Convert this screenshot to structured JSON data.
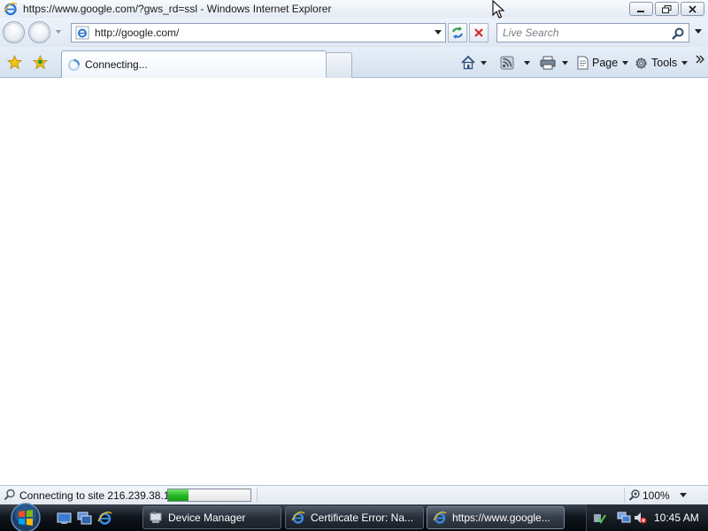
{
  "window": {
    "title": "https://www.google.com/?gws_rd=ssl - Windows Internet Explorer"
  },
  "address_bar": {
    "url": "http://google.com/"
  },
  "search": {
    "placeholder": "Live Search"
  },
  "tabs": [
    {
      "label": "Connecting...",
      "active": true
    }
  ],
  "command_bar": {
    "page_label": "Page",
    "tools_label": "Tools"
  },
  "status_bar": {
    "text": "Connecting to site 216.239.38.1",
    "progress": 0.25,
    "zoom": "100%"
  },
  "taskbar": {
    "tasks": [
      {
        "label": "Device Manager",
        "icon": "device-manager-icon"
      },
      {
        "label": "Certificate Error: Na...",
        "icon": "ie-icon"
      },
      {
        "label": "https://www.google...",
        "icon": "ie-icon"
      }
    ],
    "clock": "10:45 AM"
  },
  "colors": {
    "accent": "#1fb21f",
    "taskbar": "#11161d",
    "chrome": "#dfe8f3"
  }
}
